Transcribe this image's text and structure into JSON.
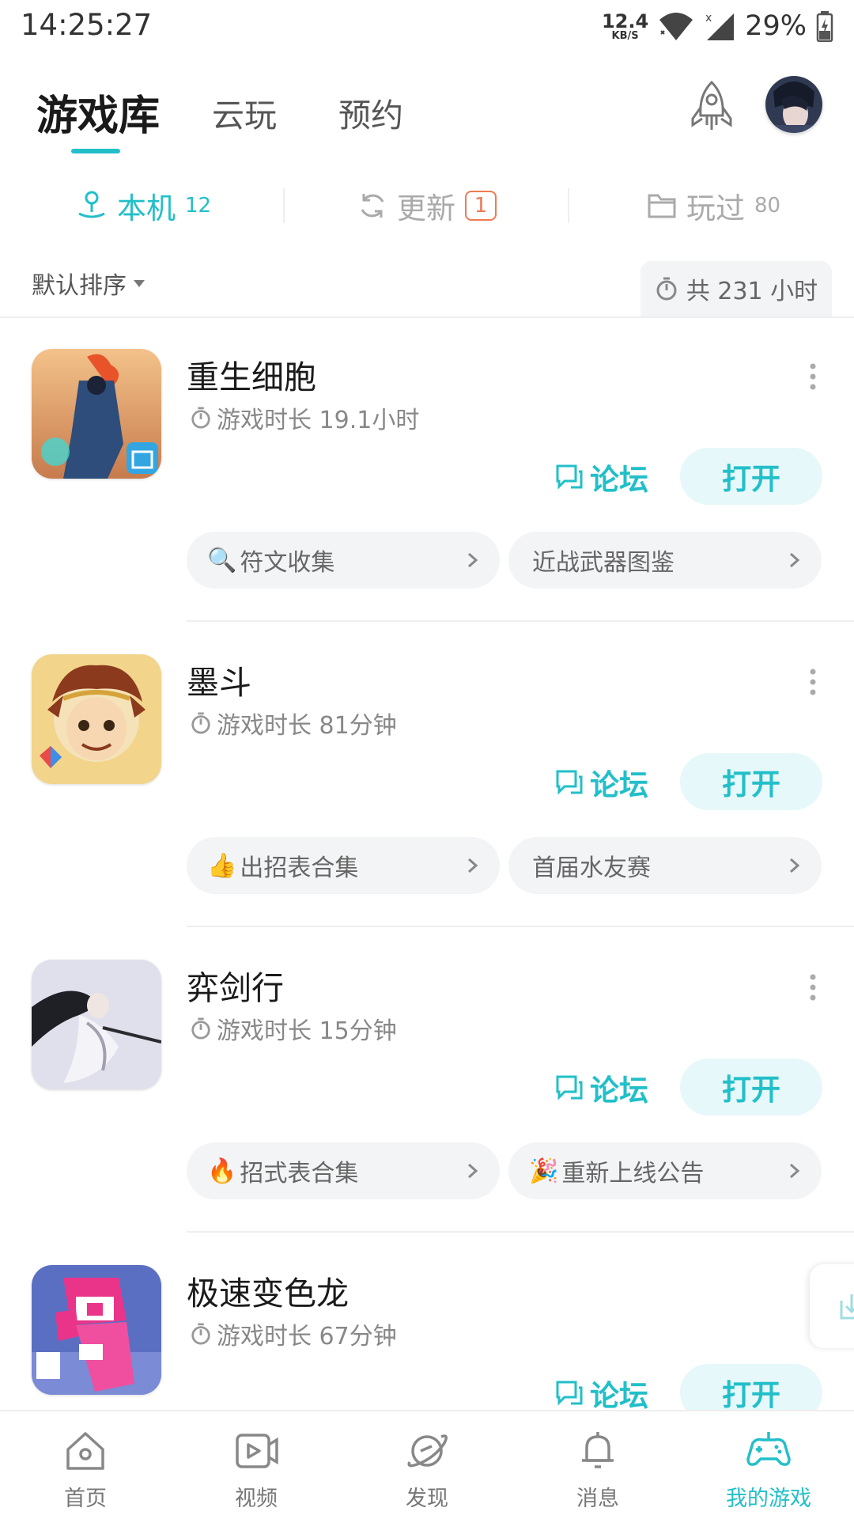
{
  "status_bar": {
    "time": "14:25:27",
    "net_speed": "12.4",
    "net_unit": "KB/S",
    "battery": "29%"
  },
  "top_tabs": {
    "library": "游戏库",
    "cloud": "云玩",
    "reserve": "预约"
  },
  "sub_tabs": {
    "local": {
      "label": "本机",
      "count": "12"
    },
    "update": {
      "label": "更新",
      "badge": "1"
    },
    "played": {
      "label": "玩过",
      "count": "80"
    }
  },
  "sort": {
    "label": "默认排序"
  },
  "total_time": "共 231 小时",
  "games": [
    {
      "title": "重生细胞",
      "duration": "游戏时长 19.1小时",
      "forum": "论坛",
      "open": "打开",
      "chip1": {
        "emoji": "🔍",
        "label": "符文收集"
      },
      "chip2": {
        "emoji": "",
        "label": "近战武器图鉴"
      }
    },
    {
      "title": "墨斗",
      "duration": "游戏时长 81分钟",
      "forum": "论坛",
      "open": "打开",
      "chip1": {
        "emoji": "👍",
        "label": "出招表合集"
      },
      "chip2": {
        "emoji": "",
        "label": "首届水友赛"
      }
    },
    {
      "title": "弈剑行",
      "duration": "游戏时长 15分钟",
      "forum": "论坛",
      "open": "打开",
      "chip1": {
        "emoji": "🔥",
        "label": "招式表合集"
      },
      "chip2": {
        "emoji": "🎉",
        "label": "重新上线公告"
      }
    },
    {
      "title": "极速变色龙",
      "duration": "游戏时长 67分钟",
      "forum": "论坛",
      "open": "打开"
    }
  ],
  "bottom_nav": {
    "home": "首页",
    "video": "视频",
    "discover": "发现",
    "messages": "消息",
    "my_games": "我的游戏"
  },
  "colors": {
    "accent": "#22bfc9",
    "badge": "#ee7a55"
  }
}
